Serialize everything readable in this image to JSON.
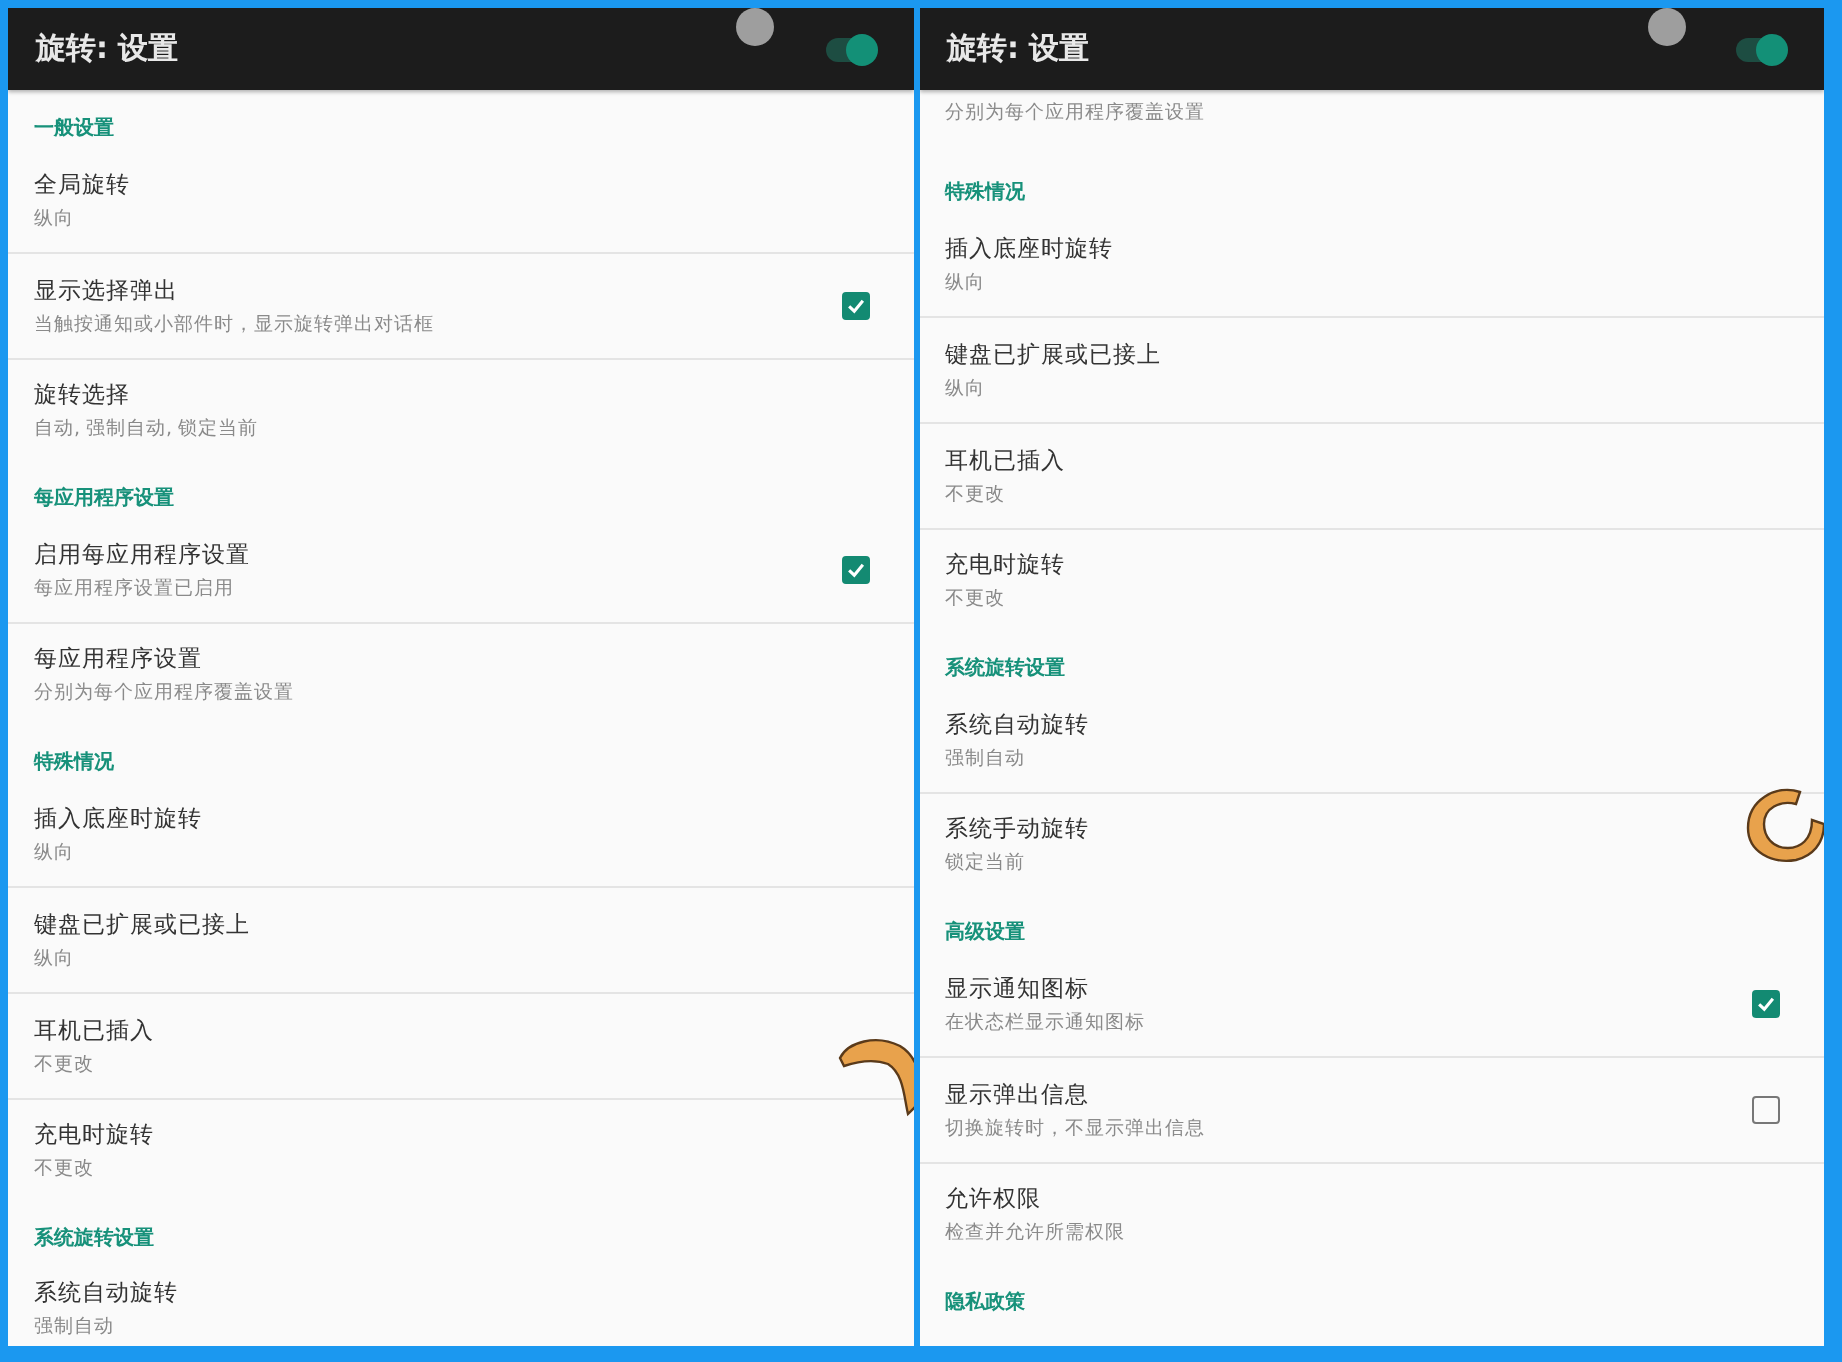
{
  "panels": [
    {
      "title": "旋转: 设置",
      "toggle_on": true,
      "items": [
        {
          "kind": "header",
          "title": "一般设置"
        },
        {
          "kind": "setting",
          "title": "全局旋转",
          "subtitle": "纵向"
        },
        {
          "kind": "check",
          "title": "显示选择弹出",
          "subtitle": "当触按通知或小部件时，显示旋转弹出对话框",
          "checked": true
        },
        {
          "kind": "setting",
          "title": "旋转选择",
          "subtitle": "自动, 强制自动, 锁定当前"
        },
        {
          "kind": "header",
          "title": "每应用程序设置"
        },
        {
          "kind": "check",
          "title": "启用每应用程序设置",
          "subtitle": "每应用程序设置已启用",
          "checked": true
        },
        {
          "kind": "setting",
          "title": "每应用程序设置",
          "subtitle": "分别为每个应用程序覆盖设置"
        },
        {
          "kind": "header",
          "title": "特殊情况"
        },
        {
          "kind": "setting",
          "title": "插入底座时旋转",
          "subtitle": "纵向"
        },
        {
          "kind": "setting",
          "title": "键盘已扩展或已接上",
          "subtitle": "纵向"
        },
        {
          "kind": "setting",
          "title": "耳机已插入",
          "subtitle": "不更改"
        },
        {
          "kind": "setting",
          "title": "充电时旋转",
          "subtitle": "不更改"
        },
        {
          "kind": "header",
          "title": "系统旋转设置"
        },
        {
          "kind": "setting",
          "title": "系统自动旋转",
          "subtitle": "强制自动"
        }
      ]
    },
    {
      "title": "旋转: 设置",
      "toggle_on": true,
      "items": [
        {
          "kind": "cut",
          "subtitle": "分别为每个应用程序覆盖设置"
        },
        {
          "kind": "header",
          "title": "特殊情况"
        },
        {
          "kind": "setting",
          "title": "插入底座时旋转",
          "subtitle": "纵向"
        },
        {
          "kind": "setting",
          "title": "键盘已扩展或已接上",
          "subtitle": "纵向"
        },
        {
          "kind": "setting",
          "title": "耳机已插入",
          "subtitle": "不更改"
        },
        {
          "kind": "setting",
          "title": "充电时旋转",
          "subtitle": "不更改"
        },
        {
          "kind": "header",
          "title": "系统旋转设置"
        },
        {
          "kind": "setting",
          "title": "系统自动旋转",
          "subtitle": "强制自动"
        },
        {
          "kind": "setting",
          "title": "系统手动旋转",
          "subtitle": "锁定当前"
        },
        {
          "kind": "header",
          "title": "高级设置"
        },
        {
          "kind": "check",
          "title": "显示通知图标",
          "subtitle": "在状态栏显示通知图标",
          "checked": true
        },
        {
          "kind": "check",
          "title": "显示弹出信息",
          "subtitle": "切换旋转时，不显示弹出信息",
          "checked": false
        },
        {
          "kind": "setting",
          "title": "允许权限",
          "subtitle": "检查并允许所需权限"
        },
        {
          "kind": "header",
          "title": "隐私政策"
        }
      ]
    }
  ]
}
